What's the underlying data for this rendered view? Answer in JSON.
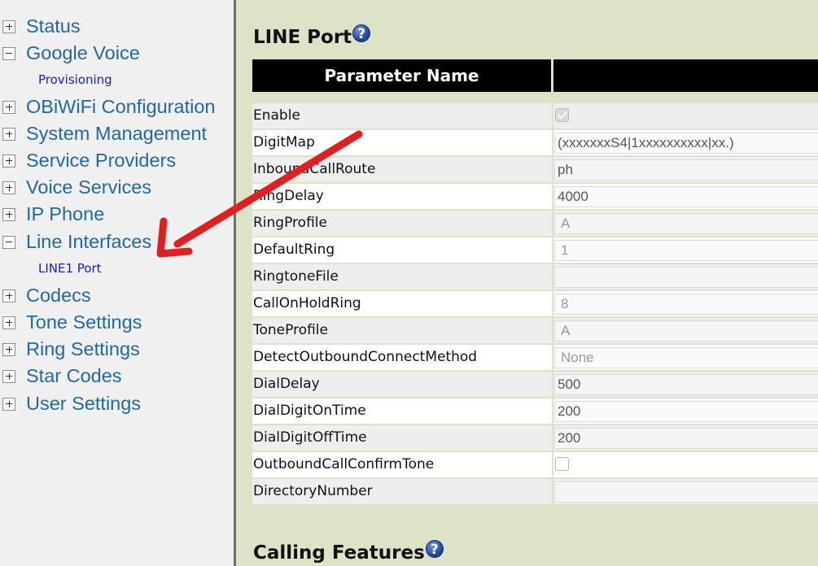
{
  "sidebar": {
    "items": [
      {
        "label": "Status",
        "expanded": false
      },
      {
        "label": "Google Voice",
        "expanded": true,
        "children": [
          "Provisioning"
        ]
      },
      {
        "label": "OBiWiFi Configuration",
        "expanded": false
      },
      {
        "label": "System Management",
        "expanded": false
      },
      {
        "label": "Service Providers",
        "expanded": false
      },
      {
        "label": "Voice Services",
        "expanded": false
      },
      {
        "label": "IP Phone",
        "expanded": false
      },
      {
        "label": "Line Interfaces",
        "expanded": true,
        "children": [
          "LINE1 Port"
        ]
      },
      {
        "label": "Codecs",
        "expanded": false
      },
      {
        "label": "Tone Settings",
        "expanded": false
      },
      {
        "label": "Ring Settings",
        "expanded": false
      },
      {
        "label": "Star Codes",
        "expanded": false
      },
      {
        "label": "User Settings",
        "expanded": false
      }
    ]
  },
  "main": {
    "section_title": "LINE Port",
    "table_header": {
      "parameter_name": "Parameter Name",
      "value": ""
    },
    "rows": [
      {
        "name": "Enable",
        "type": "checkbox",
        "checked": true,
        "disabled": true,
        "value": ""
      },
      {
        "name": "DigitMap",
        "type": "text",
        "value": "(xxxxxxxS4|1xxxxxxxxxx|xx.)"
      },
      {
        "name": "InboundCallRoute",
        "type": "text",
        "value": "ph"
      },
      {
        "name": "RingDelay",
        "type": "text",
        "value": "4000"
      },
      {
        "name": "RingProfile",
        "type": "select",
        "disabled": true,
        "value": "A"
      },
      {
        "name": "DefaultRing",
        "type": "select",
        "disabled": true,
        "value": "1"
      },
      {
        "name": "RingtoneFile",
        "type": "text",
        "value": ""
      },
      {
        "name": "CallOnHoldRing",
        "type": "select",
        "disabled": true,
        "value": "8"
      },
      {
        "name": "ToneProfile",
        "type": "select",
        "disabled": true,
        "value": "A"
      },
      {
        "name": "DetectOutboundConnectMethod",
        "type": "select",
        "disabled": true,
        "value": "None"
      },
      {
        "name": "DialDelay",
        "type": "text",
        "value": "500"
      },
      {
        "name": "DialDigitOnTime",
        "type": "text",
        "value": "200"
      },
      {
        "name": "DialDigitOffTime",
        "type": "text",
        "value": "200"
      },
      {
        "name": "OutboundCallConfirmTone",
        "type": "checkbox",
        "checked": false,
        "disabled": false,
        "value": ""
      },
      {
        "name": "DirectoryNumber",
        "type": "text",
        "value": ""
      }
    ],
    "next_section_title": "Calling Features"
  },
  "colors": {
    "sidebar_bg": "#f0f0f0",
    "nav_link": "#2168a6",
    "sub_link": "#1a1acc",
    "content_bg": "#dde3c7",
    "header_bg": "#000000",
    "arrow": "#e02020"
  },
  "icons": {
    "help": "help-icon",
    "expand": "plus-box-icon",
    "collapse": "minus-box-icon"
  }
}
